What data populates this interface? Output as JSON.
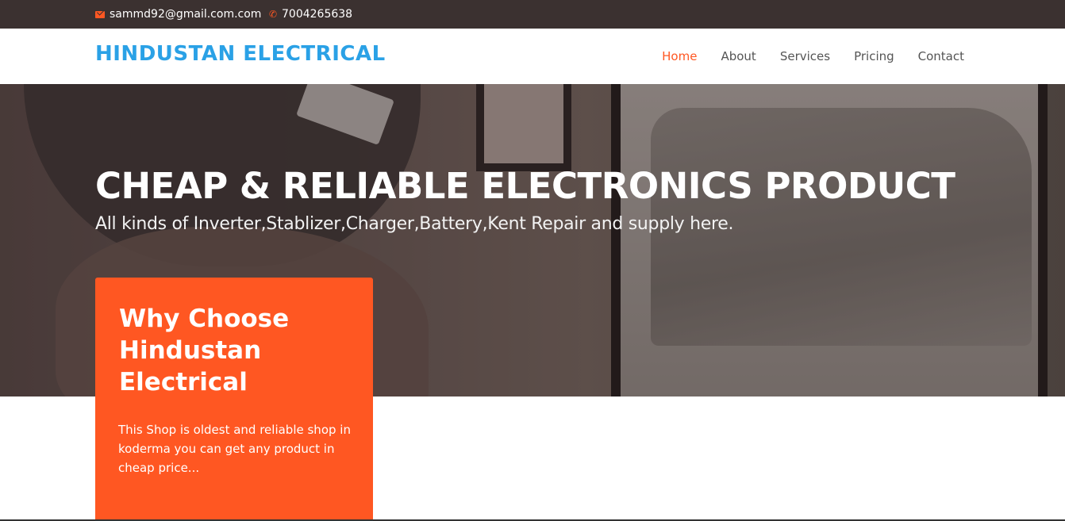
{
  "topbar": {
    "email": "sammd92@gmail.com.com",
    "phone": "7004265638",
    "email_icon": "envelope-icon",
    "phone_icon": "phone-icon"
  },
  "header": {
    "logo": "HINDUSTAN ELECTRICAL",
    "nav": [
      {
        "label": "Home",
        "active": true
      },
      {
        "label": "About",
        "active": false
      },
      {
        "label": "Services",
        "active": false
      },
      {
        "label": "Pricing",
        "active": false
      },
      {
        "label": "Contact",
        "active": false
      }
    ]
  },
  "hero": {
    "title": "CHEAP & RELIABLE ELECTRONICS PRODUCT",
    "subtitle": "All kinds of Inverter,Stablizer,Charger,Battery,Kent Repair and supply here."
  },
  "why_card": {
    "title": "Why Choose Hindustan Electrical",
    "text": "This Shop is oldest and reliable shop in koderma you can get any product in cheap price..."
  },
  "colors": {
    "accent": "#ff5722",
    "brand": "#2aa1e6",
    "topbar": "#3b3130"
  }
}
